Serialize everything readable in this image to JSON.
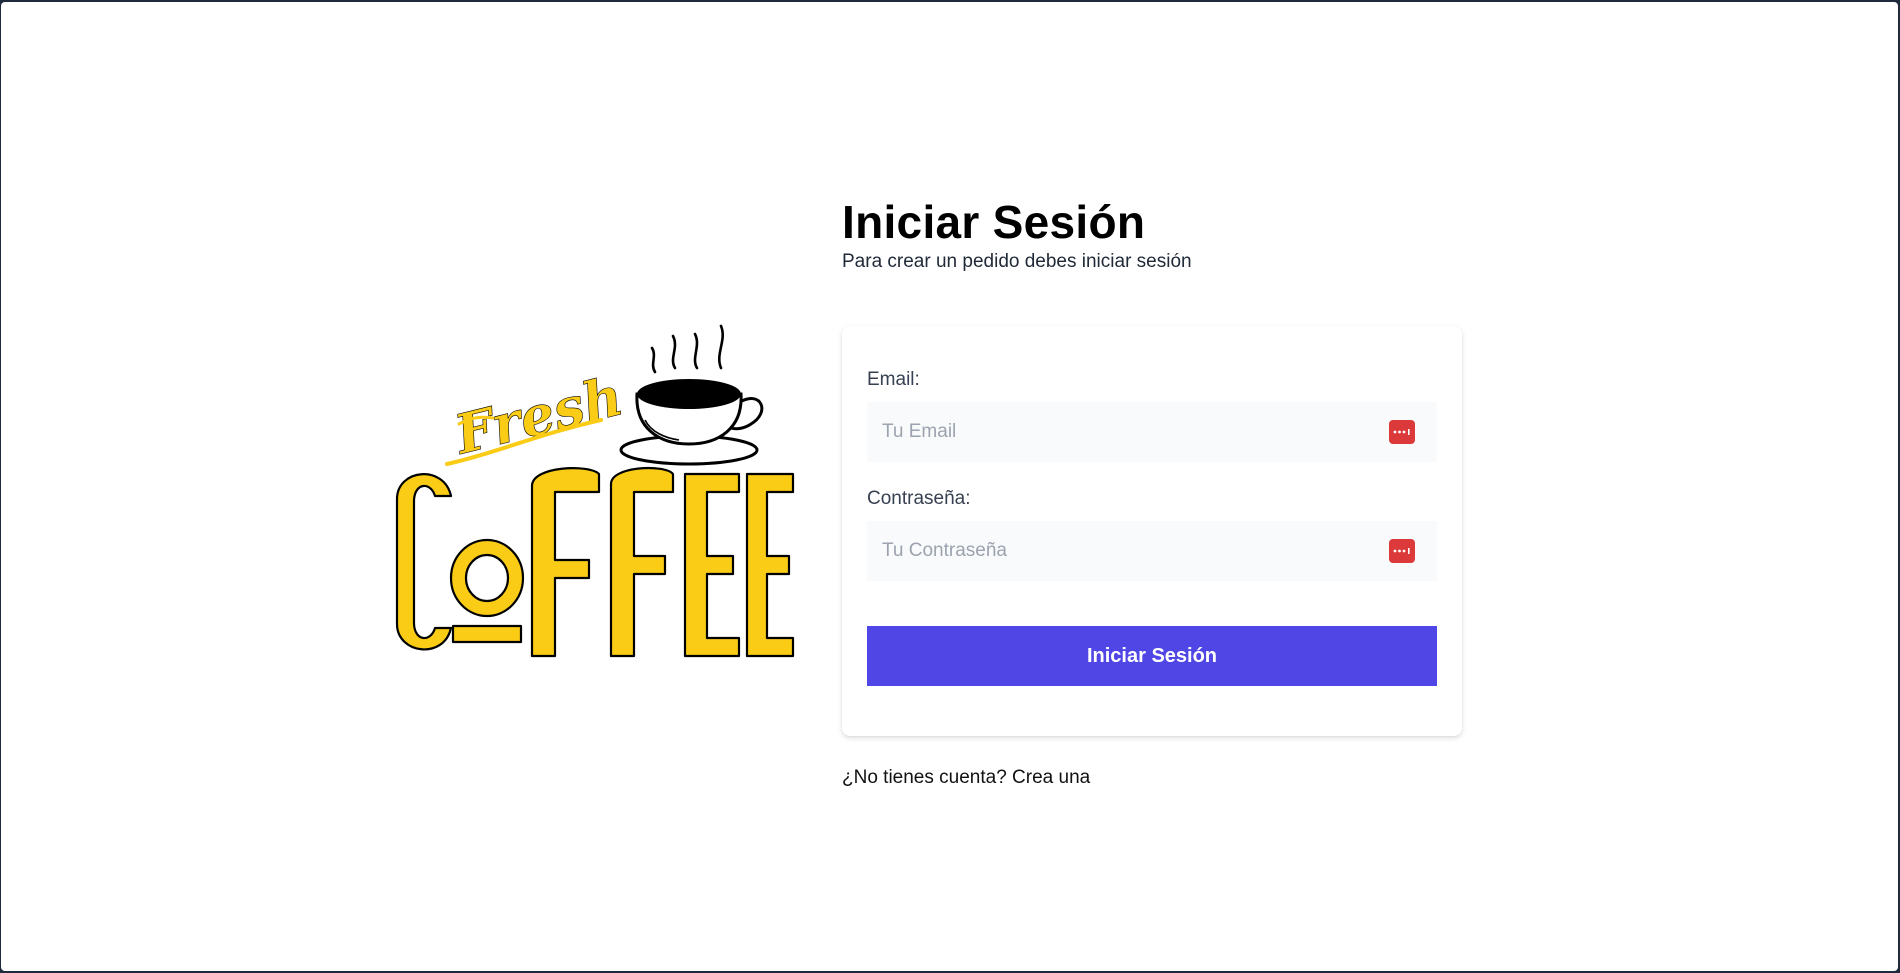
{
  "logo": {
    "script_text": "Fresh",
    "main_text": "COFFEE",
    "brand_color": "#facc15",
    "icon": "coffee-cup-icon"
  },
  "login": {
    "title": "Iniciar Sesión",
    "subtitle": "Para crear un pedido debes iniciar sesión",
    "email": {
      "label": "Email:",
      "placeholder": "Tu Email",
      "value": "",
      "icon": "password-manager-icon"
    },
    "password": {
      "label": "Contraseña:",
      "placeholder": "Tu Contraseña",
      "value": "",
      "icon": "password-manager-icon"
    },
    "submit_label": "Iniciar Sesión",
    "signup_link": "¿No tienes cuenta? Crea una"
  },
  "colors": {
    "primary": "#4f46e5",
    "input_bg": "#f9fafb",
    "password_icon": "#dc3a3a"
  }
}
